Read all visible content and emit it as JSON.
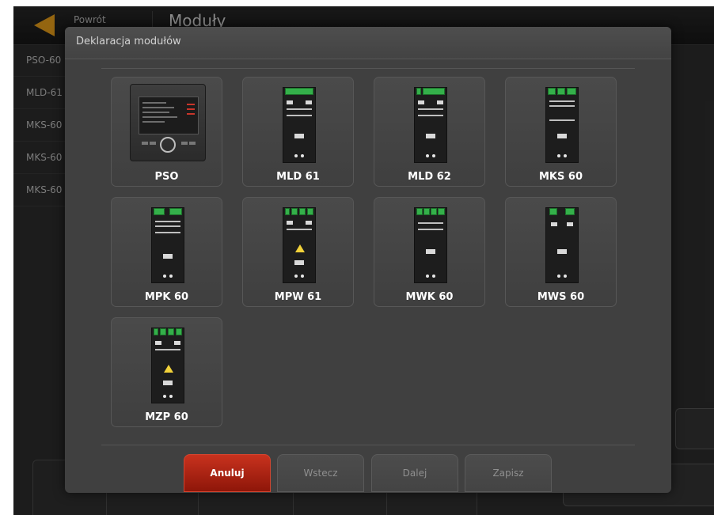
{
  "topbar": {
    "back_label": "Powrót",
    "title": "Moduły"
  },
  "sidebar": {
    "items": [
      "PSO-60 (",
      "MLD-61",
      "MKS-60",
      "MKS-60",
      "MKS-60"
    ]
  },
  "dialog": {
    "title": "Deklaracja modułów",
    "modules": [
      {
        "label": "PSO"
      },
      {
        "label": "MLD 61"
      },
      {
        "label": "MLD 62"
      },
      {
        "label": "MKS 60"
      },
      {
        "label": "MPK 60"
      },
      {
        "label": "MPW 61"
      },
      {
        "label": "MWK 60"
      },
      {
        "label": "MWS 60"
      },
      {
        "label": "MZP 60"
      }
    ],
    "buttons": {
      "cancel": "Anuluj",
      "back": "Wstecz",
      "next": "Dalej",
      "save": "Zapisz"
    }
  },
  "colors": {
    "accent": "#e39b1a",
    "primary_button": "#b8271a",
    "terminal_green": "#34b04a"
  }
}
